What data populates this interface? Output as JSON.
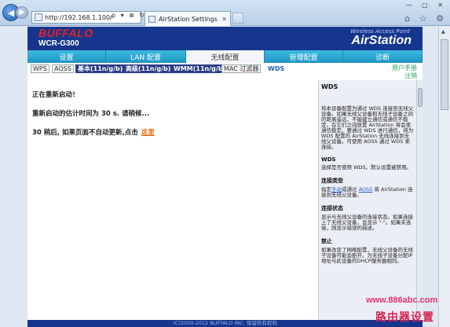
{
  "browser": {
    "address": "http://192.168.1.100/",
    "address_tools": "ρ ▾ ⊗ ↻ ✕",
    "tab_title": "AirStation Settings",
    "tab_close": "✕",
    "window_controls": "— ▢ ✕",
    "toolbar_icons": "⌂ ☆ ⚙"
  },
  "header": {
    "logo": "BUFFALO",
    "model": "WCR-G300",
    "tagline": "Wireless Access Point",
    "product": "AirStation"
  },
  "menu": {
    "items": [
      {
        "label": "设置"
      },
      {
        "label": "LAN 配置"
      },
      {
        "label": "无线配置"
      },
      {
        "label": "管理配置"
      },
      {
        "label": "诊断"
      }
    ]
  },
  "submenu": {
    "items": [
      {
        "label": "WPS"
      },
      {
        "label": "AOSS"
      },
      {
        "label": "基本(11n/g/b)"
      },
      {
        "label": "高级(11n/g/b)"
      },
      {
        "label": "WMM(11n/g/b)"
      },
      {
        "label": "MAC 过滤器"
      },
      {
        "label": "WDS"
      }
    ],
    "manual": "用户手册",
    "logout": "注销"
  },
  "main": {
    "line1": "正在重新启动！",
    "line2": "重新启动的估计时间为  30 s. 请稍候...",
    "line3": "30 稍后, 如果页面不自动更新,点击",
    "here": "这里"
  },
  "help": {
    "title": "WDS",
    "p1": "将本设备配置为通过 WDS 连接到无线父设备。如果无线父设备和无线子设备之间的距离遥远，不能建立通信或通信不稳定，在它们之间放置 AirStation 将会使通信稳定。要通过 WDS 进行通信，将为 WDS 配置的 AirStation 无线连接到无线父设备。可使用 AOSS 通过 WDS 来连接。",
    "h2": "WDS",
    "p2": "选择是否使用 WDS。默认设置被禁用。",
    "h3": "连接类型",
    "p3_pre": "指定",
    "p3_link1": "手动",
    "p3_mid": "或通过",
    "p3_link2": "AOSS",
    "p3_post": "将 AirStation 连接到无线父设备。",
    "h4": "连接状态",
    "p4": "显示与无线父设备的连接状态。如果连接上了无线父设备，会显示 \"-\"。如果未连接，则显示错误的描述。",
    "h5": "禁止",
    "p5": "如果改变了网络配置，无线父设备的无线子设备可能会断开。为无线子设备分配IP地址与此设备的DHCP服务器相同。"
  },
  "footer": {
    "text": "(C)2000-2012 BUFFALO INC. 保留所有权利"
  },
  "watermark": {
    "url": "www.886abc.com",
    "text": "路由器设置"
  }
}
